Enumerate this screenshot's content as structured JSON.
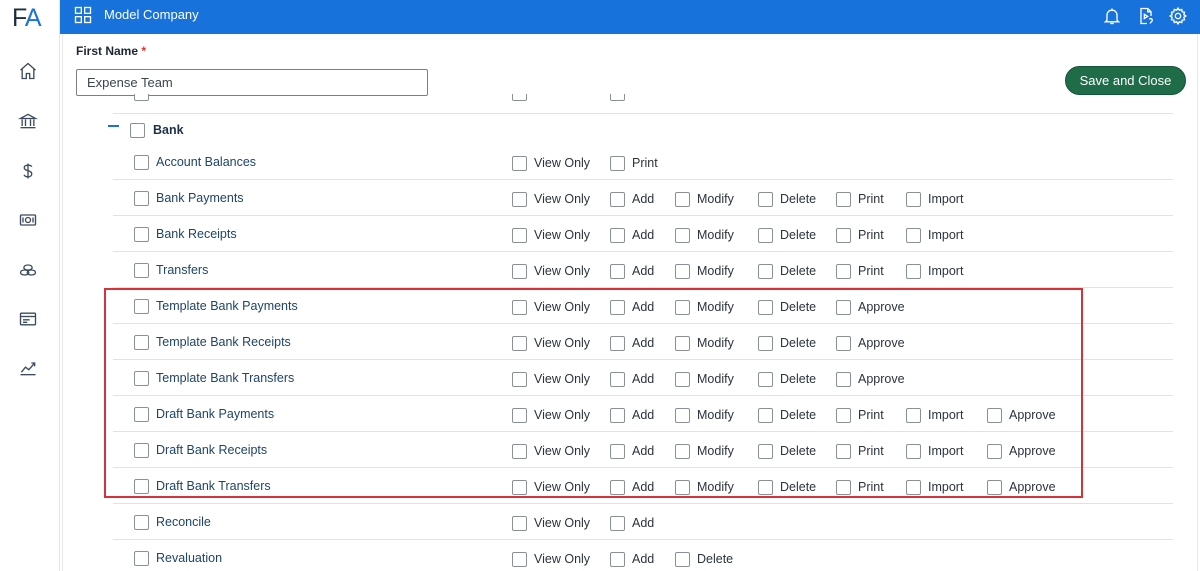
{
  "logo": {
    "left": "F",
    "right": "A"
  },
  "rail": {
    "icons": [
      "home-icon",
      "bank-icon",
      "dollar-icon",
      "cash-icon",
      "coins-icon",
      "card-icon",
      "chart-icon"
    ]
  },
  "topbar": {
    "company": "Model Company",
    "icons": [
      "bell-icon",
      "play-doc-icon",
      "gear-icon"
    ]
  },
  "form": {
    "first_name_label": "First Name",
    "required_mark": "*",
    "first_name_value": "Expense Team",
    "save_label": "Save and Close"
  },
  "group": {
    "label": "Bank"
  },
  "rows": [
    {
      "label": "Account Balances",
      "perms": [
        "View Only",
        "Print"
      ]
    },
    {
      "label": "Bank Payments",
      "perms": [
        "View Only",
        "Add",
        "Modify",
        "Delete",
        "Print",
        "Import"
      ]
    },
    {
      "label": "Bank Receipts",
      "perms": [
        "View Only",
        "Add",
        "Modify",
        "Delete",
        "Print",
        "Import"
      ]
    },
    {
      "label": "Transfers",
      "perms": [
        "View Only",
        "Add",
        "Modify",
        "Delete",
        "Print",
        "Import"
      ]
    },
    {
      "label": "Template Bank Payments",
      "perms": [
        "View Only",
        "Add",
        "Modify",
        "Delete",
        "Approve"
      ]
    },
    {
      "label": "Template Bank Receipts",
      "perms": [
        "View Only",
        "Add",
        "Modify",
        "Delete",
        "Approve"
      ]
    },
    {
      "label": "Template Bank Transfers",
      "perms": [
        "View Only",
        "Add",
        "Modify",
        "Delete",
        "Approve"
      ]
    },
    {
      "label": "Draft Bank Payments",
      "perms": [
        "View Only",
        "Add",
        "Modify",
        "Delete",
        "Print",
        "Import",
        "Approve"
      ]
    },
    {
      "label": "Draft Bank Receipts",
      "perms": [
        "View Only",
        "Add",
        "Modify",
        "Delete",
        "Print",
        "Import",
        "Approve"
      ]
    },
    {
      "label": "Draft Bank Transfers",
      "perms": [
        "View Only",
        "Add",
        "Modify",
        "Delete",
        "Print",
        "Import",
        "Approve"
      ]
    },
    {
      "label": "Reconcile",
      "perms": [
        "View Only",
        "Add"
      ]
    },
    {
      "label": "Revaluation",
      "perms": [
        "View Only",
        "Add",
        "Delete"
      ]
    }
  ],
  "colors": {
    "topbar": "#1773db",
    "save_button": "#1f6c48",
    "highlight_border": "#d8313a",
    "link_text": "#1e4468"
  }
}
